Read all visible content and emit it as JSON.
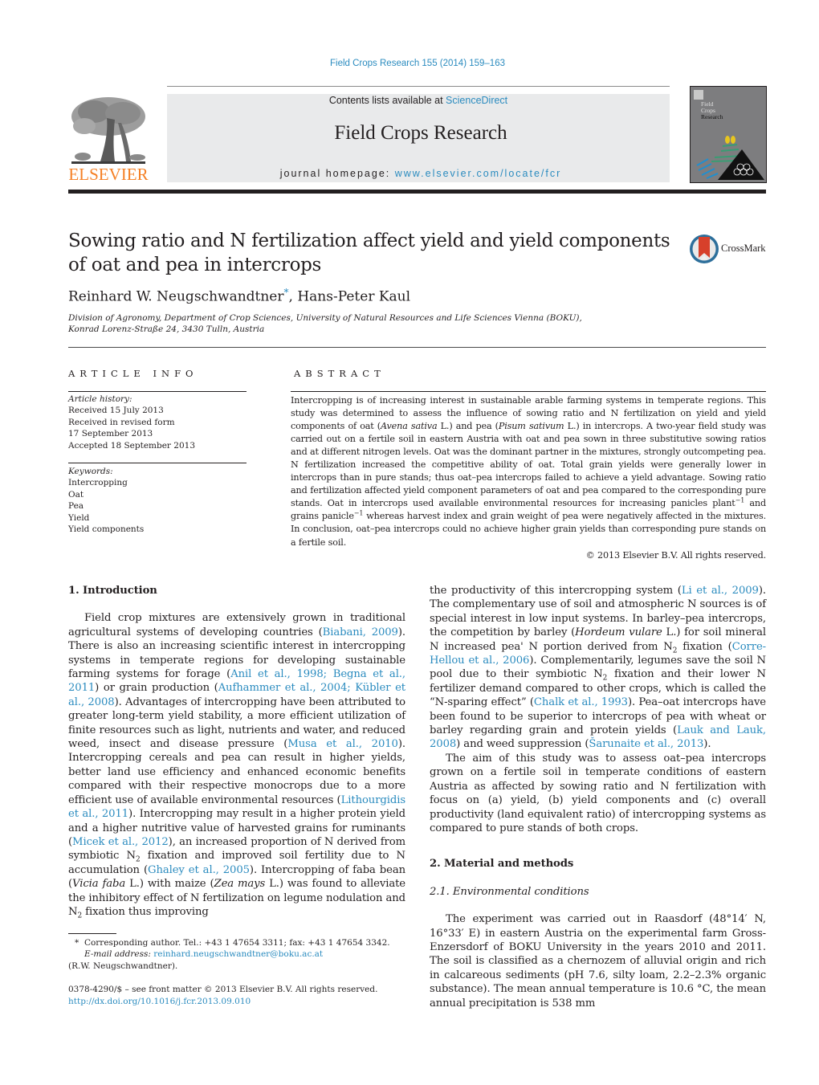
{
  "header": {
    "citation": "Field Crops Research 155 (2014) 159–163",
    "contents_prefix": "Contents lists available at ",
    "contents_link": "ScienceDirect",
    "journal_title": "Field Crops Research",
    "homepage_prefix": "journal homepage: ",
    "homepage_link": "www.elsevier.com/locate/fcr",
    "publisher_logo": "ELSEVIER",
    "cover_title_lines": [
      "Field",
      "Crops",
      "Research"
    ],
    "crossmark_label": "CrossMark"
  },
  "article": {
    "title": "Sowing ratio and N fertilization affect yield and yield components of oat and pea in intercrops",
    "authors": [
      {
        "name": "Reinhard W. Neugschwandtner",
        "mark": "*"
      },
      {
        "name": "Hans-Peter Kaul",
        "mark": ""
      }
    ],
    "author_separator": ", ",
    "affiliation_lines": [
      "Division of Agronomy, Department of Crop Sciences, University of Natural Resources and Life Sciences Vienna (BOKU),",
      "Konrad Lorenz-Straße 24, 3430 Tulln, Austria"
    ]
  },
  "article_info": {
    "heading": "ARTICLE INFO",
    "history_label": "Article history:",
    "history": [
      "Received 15 July 2013",
      "Received in revised form",
      "17 September 2013",
      "Accepted 18 September 2013"
    ],
    "keywords_label": "Keywords:",
    "keywords": [
      "Intercropping",
      "Oat",
      "Pea",
      "Yield",
      "Yield components"
    ]
  },
  "abstract": {
    "heading": "ABSTRACT",
    "parts": {
      "a1": "Intercropping is of increasing interest in sustainable arable farming systems in temperate regions. This study was determined to assess the influence of sowing ratio and N fertilization on yield and yield components of oat (",
      "a_sp1": "Avena sativa",
      "a2": " L.) and pea (",
      "a_sp2": "Pisum sativum",
      "a3": " L.) in intercrops. A two-year field study was carried out on a fertile soil in eastern Austria with oat and pea sown in three substitutive sowing ratios and at different nitrogen levels. Oat was the dominant partner in the mixtures, strongly outcompeting pea. N fertilization increased the competitive ability of oat. Total grain yields were generally lower in intercrops than in pure stands; thus oat–pea intercrops failed to achieve a yield advantage. Sowing ratio and fertilization affected yield component parameters of oat and pea compared to the corresponding pure stands. Oat in intercrops used available environmental resources for increasing panicles plant",
      "a_exp1": "−1",
      "a4": " and grains panicle",
      "a_exp2": "−1",
      "a5": " whereas harvest index and grain weight of pea were negatively affected in the mixtures. In conclusion, oat–pea intercrops could no achieve higher grain yields than corresponding pure stands on a fertile soil."
    },
    "copyright": "© 2013 Elsevier B.V. All rights reserved."
  },
  "intro": {
    "heading": "1.  Introduction",
    "p1": {
      "t1": "Field crop mixtures are extensively grown in traditional agricultural systems of developing countries (",
      "r1": "Biabani, 2009",
      "t2": "). There is also an increasing scientific interest in intercropping systems in temperate regions for developing sustainable farming systems for forage (",
      "r2": "Anil et al., 1998; Begna et al., 2011",
      "t3": ") or grain production (",
      "r3": "Aufhammer et al., 2004; Kübler et al., 2008",
      "t4": "). Advantages of intercropping have been attributed to greater long-term yield stability, a more efficient utilization of finite resources such as light, nutrients and water, and reduced weed, insect and disease pressure (",
      "r4": "Musa et al., 2010",
      "t5": "). Intercropping cereals and pea can result in higher yields, better land use efficiency and enhanced economic benefits compared with their respective monocrops due to a more efficient use of available environmental resources (",
      "r5": "Lithourgidis et al., 2011",
      "t6": "). Intercropping may result in a higher protein yield and a higher nutritive value of harvested grains for ruminants (",
      "r6": "Micek et al., 2012",
      "t7": "), an increased proportion of N derived from symbiotic N",
      "s1": "2",
      "t8": " fixation and improved soil fertility due to N accumulation (",
      "r7": "Ghaley et al., 2005",
      "t9": "). Intercropping of faba bean (",
      "i1": "Vicia faba",
      "t10": " L.) with maize (",
      "i2": "Zea mays",
      "t11": " L.) was found to alleviate the inhibitory effect of N fertilization on legume nodulation and N",
      "s2": "2",
      "t12": " fixation thus improving the productivity of this intercropping system (",
      "r8": "Li et al., 2009",
      "t13": "). The complementary use of soil and atmospheric N sources is of special interest in low input systems. In barley–pea intercrops, the competition by barley (",
      "i3": "Hordeum vulare",
      "t14": " L.) for soil mineral N increased pea' N portion derived from N",
      "s3": "2",
      "t15": " fixation (",
      "r9": "Corre-Hellou et al., 2006",
      "t16": "). Complementarily, legumes save the soil N pool due to their symbiotic N",
      "s4": "2",
      "t17": " fixation and their lower N fertilizer demand compared to other crops, which is called the “N-sparing effect” (",
      "r10": "Chalk et al., 1993",
      "t18": "). Pea–oat intercrops have been found to be superior to intercrops of pea with wheat or barley regarding grain and protein yields (",
      "r11": "Lauk and Lauk, 2008",
      "t19": ") and weed suppression (",
      "r12": "Šarunaite et al., 2013",
      "t20": ")."
    },
    "p2": "The aim of this study was to assess oat–pea intercrops grown on a fertile soil in temperate conditions of eastern Austria as affected by sowing ratio and N fertilization with focus on (a) yield, (b) yield components and (c) overall productivity (land equivalent ratio) of intercropping systems as compared to pure stands of both crops."
  },
  "methods": {
    "heading": "2.  Material and methods",
    "subheading": "2.1.  Environmental conditions",
    "p1": "The experiment was carried out in Raasdorf (48°14′ N, 16°33′ E) in eastern Austria on the experimental farm Gross-Enzersdorf of BOKU University in the years 2010 and 2011. The soil is classified as a chernozem of alluvial origin and rich in calcareous sediments (pH 7.6, silty loam, 2.2–2.3% organic substance). The mean annual temperature is 10.6 °C, the mean annual precipitation is 538 mm"
  },
  "footnote": {
    "mark": "*",
    "text": "Corresponding author. Tel.: +43 1 47654 3311; fax: +43 1 47654 3342.",
    "email_label": "E-mail address: ",
    "email": "reinhard.neugschwandtner@boku.ac.at",
    "email_owner": "(R.W. Neugschwandtner)."
  },
  "footer": {
    "issn": "0378-4290/$ – see front matter © 2013 Elsevier B.V. All rights reserved.",
    "doi": "http://dx.doi.org/10.1016/j.fcr.2013.09.010"
  },
  "colors": {
    "link": "#2a8bbf",
    "elsevier_orange": "#f58025",
    "banner_gray": "#e9eaeb",
    "text": "#231f20"
  }
}
